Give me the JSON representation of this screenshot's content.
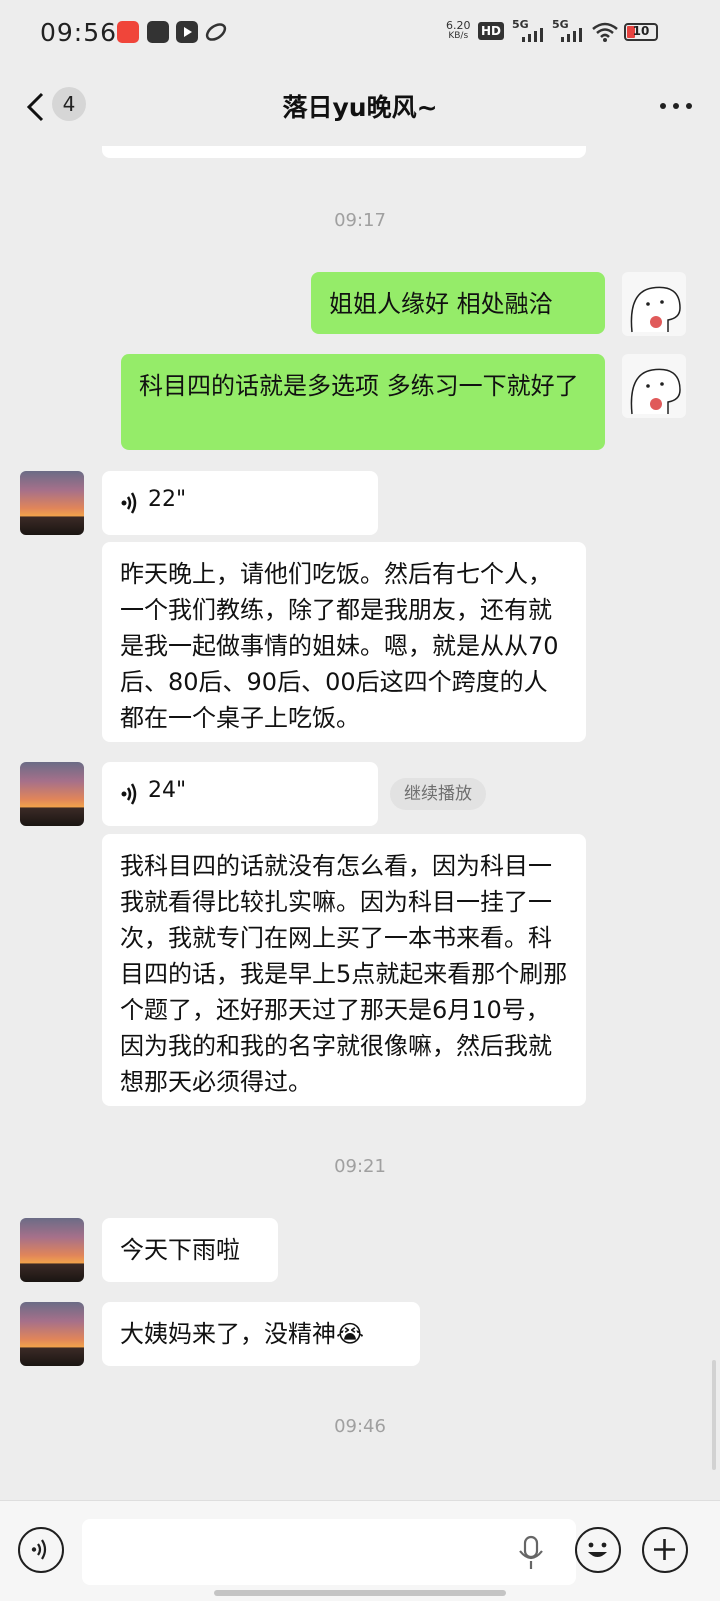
{
  "status_bar": {
    "time": "09:56",
    "net_speed_value": "6.20",
    "net_speed_unit": "KB/s",
    "hd_label": "HD",
    "network_1": "5G",
    "network_2": "5G",
    "battery": "10",
    "app_icons": [
      "app-red-icon",
      "message-icon",
      "video-icon",
      "leaf-icon"
    ]
  },
  "header": {
    "back_count": "4",
    "title": "落日yu晚风~"
  },
  "messages": {
    "time_1": "09:17",
    "me_1": "姐姐人缘好 相处融洽",
    "me_2": "科目四的话就是多选项 多练习一下就好了",
    "voice_1": "22\"",
    "text_1": "昨天晚上，请他们吃饭。然后有七个人，一个我们教练，除了都是我朋友，还有就是我一起做事情的姐妹。嗯，就是从从70后、80后、90后、00后这四个跨度的人都在一个桌子上吃饭。",
    "voice_2": "24\"",
    "continue_play": "继续播放",
    "text_2": "我科目四的话就没有怎么看，因为科目一我就看得比较扎实嘛。因为科目一挂了一次，我就专门在网上买了一本书来看。科目四的话，我是早上5点就起来看那个刷那个题了，还好那天过了那天是6月10号，因为我的和我的名字就很像嘛，然后我就想那天必须得过。",
    "time_2": "09:21",
    "text_3": "今天下雨啦",
    "text_4": "大姨妈来了，没精神",
    "text_4_emoji": "😭",
    "time_3": "09:46"
  },
  "input_bar": {
    "value": "",
    "icons": [
      "voice-mode-icon",
      "microphone-icon",
      "emoji-icon",
      "plus-icon"
    ]
  },
  "colors": {
    "background": "#ededed",
    "my_bubble": "#95ec69",
    "their_bubble": "#ffffff"
  }
}
